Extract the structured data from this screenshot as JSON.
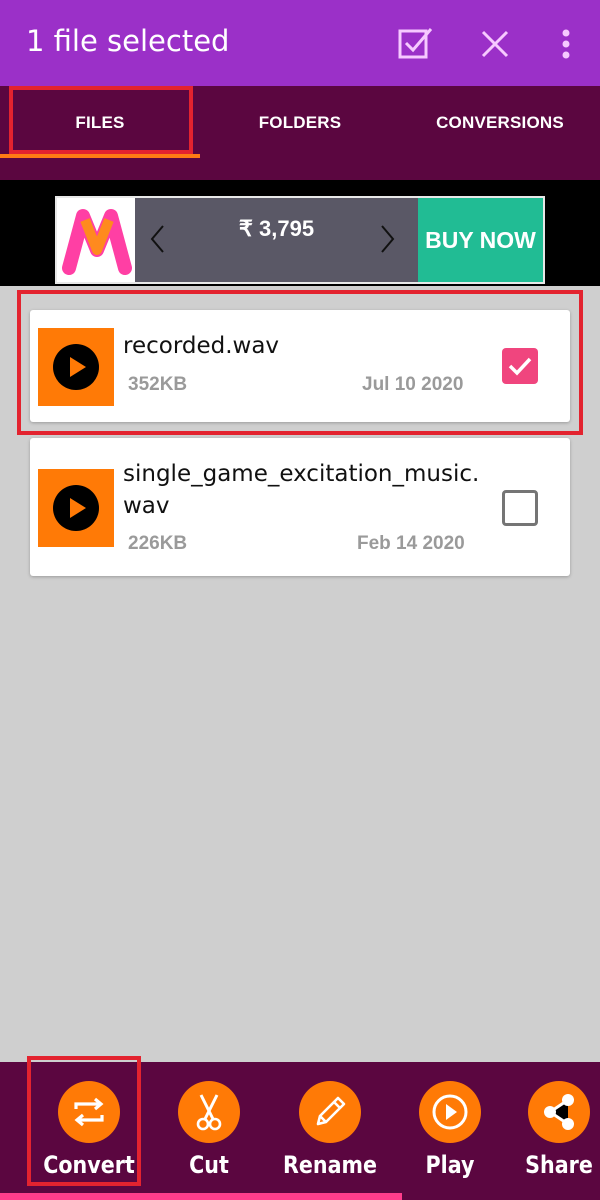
{
  "appbar": {
    "title": "1 file selected",
    "icons": [
      "select-all-icon",
      "close-icon",
      "more-vert-icon"
    ]
  },
  "tabs": [
    {
      "label": "FILES",
      "active": true
    },
    {
      "label": "FOLDERS",
      "active": false
    },
    {
      "label": "CONVERSIONS",
      "active": false
    }
  ],
  "ad": {
    "brand": "Myntra",
    "price": "₹ 3,795",
    "cta": "BUY NOW",
    "colors": {
      "cta": "#21bc94"
    }
  },
  "files": [
    {
      "name": "recorded.wav",
      "size": "352KB",
      "date": "Jul 10 2020",
      "selected": true
    },
    {
      "name": "single_game_excitation_music.wav",
      "name_line1": "single_game_excitation_music.",
      "name_line2": "wav",
      "size": "226KB",
      "date": "Feb 14 2020",
      "selected": false
    }
  ],
  "actions": [
    {
      "label": "Convert",
      "icon": "convert-icon"
    },
    {
      "label": "Cut",
      "icon": "scissors-icon"
    },
    {
      "label": "Rename",
      "icon": "pencil-icon"
    },
    {
      "label": "Play",
      "icon": "play-circle-icon"
    },
    {
      "label": "Share",
      "icon": "share-icon"
    }
  ],
  "colors": {
    "appbar": "#9b30c8",
    "tabbar": "#5b0640",
    "accent": "#ff7a06",
    "checkbox_selected": "#f0457e",
    "highlight": "#e3232f"
  }
}
